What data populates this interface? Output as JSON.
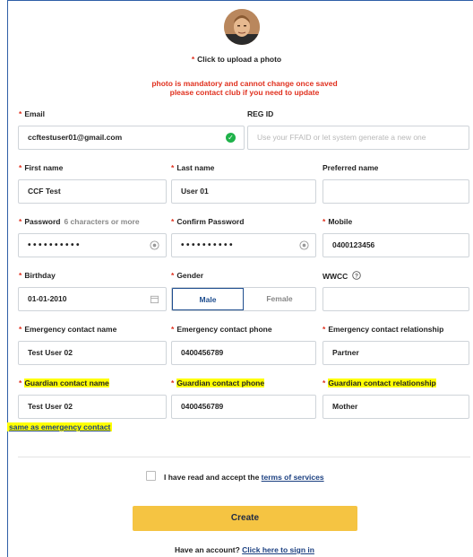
{
  "header": {
    "upload_label": "Click to upload a photo",
    "warning_line1": "photo is mandatory and cannot change once saved",
    "warning_line2": "please contact club if you need to update"
  },
  "fields": {
    "email": {
      "label": "Email",
      "value": "ccftestuser01@gmail.com"
    },
    "reg_id": {
      "label": "REG ID",
      "placeholder": "Use your FFAID or let system generate a new one"
    },
    "first_name": {
      "label": "First name",
      "value": "CCF Test"
    },
    "last_name": {
      "label": "Last name",
      "value": "User 01"
    },
    "preferred_name": {
      "label": "Preferred name",
      "value": ""
    },
    "password": {
      "label": "Password",
      "hint": "6 characters or more",
      "value": "••••••••••"
    },
    "confirm_password": {
      "label": "Confirm Password",
      "value": "••••••••••"
    },
    "mobile": {
      "label": "Mobile",
      "value": "0400123456"
    },
    "birthday": {
      "label": "Birthday",
      "value": "01-01-2010"
    },
    "gender": {
      "label": "Gender",
      "options": [
        "Male",
        "Female"
      ],
      "selected": "Male"
    },
    "wwcc": {
      "label": "WWCC",
      "value": ""
    },
    "emergency_name": {
      "label": "Emergency contact name",
      "value": "Test User 02"
    },
    "emergency_phone": {
      "label": "Emergency contact phone",
      "value": "0400456789"
    },
    "emergency_relationship": {
      "label": "Emergency contact relationship",
      "value": "Partner"
    },
    "guardian_name": {
      "label": "Guardian contact name",
      "value": "Test User 02"
    },
    "guardian_phone": {
      "label": "Guardian contact phone",
      "value": "0400456789"
    },
    "guardian_relationship": {
      "label": "Guardian contact relationship",
      "value": "Mother"
    }
  },
  "same_as_emergency": "same as emergency contact",
  "terms": {
    "prefix": "I have read and accept the",
    "link": "terms of services"
  },
  "create_button": "Create",
  "signin": {
    "prefix": "Have an account?",
    "link": "Click here to sign in"
  },
  "colors": {
    "required": "#e0301e",
    "highlight": "#ffff00",
    "primary_button": "#f5c442",
    "link": "#1a3f80",
    "valid": "#1fb24a"
  }
}
